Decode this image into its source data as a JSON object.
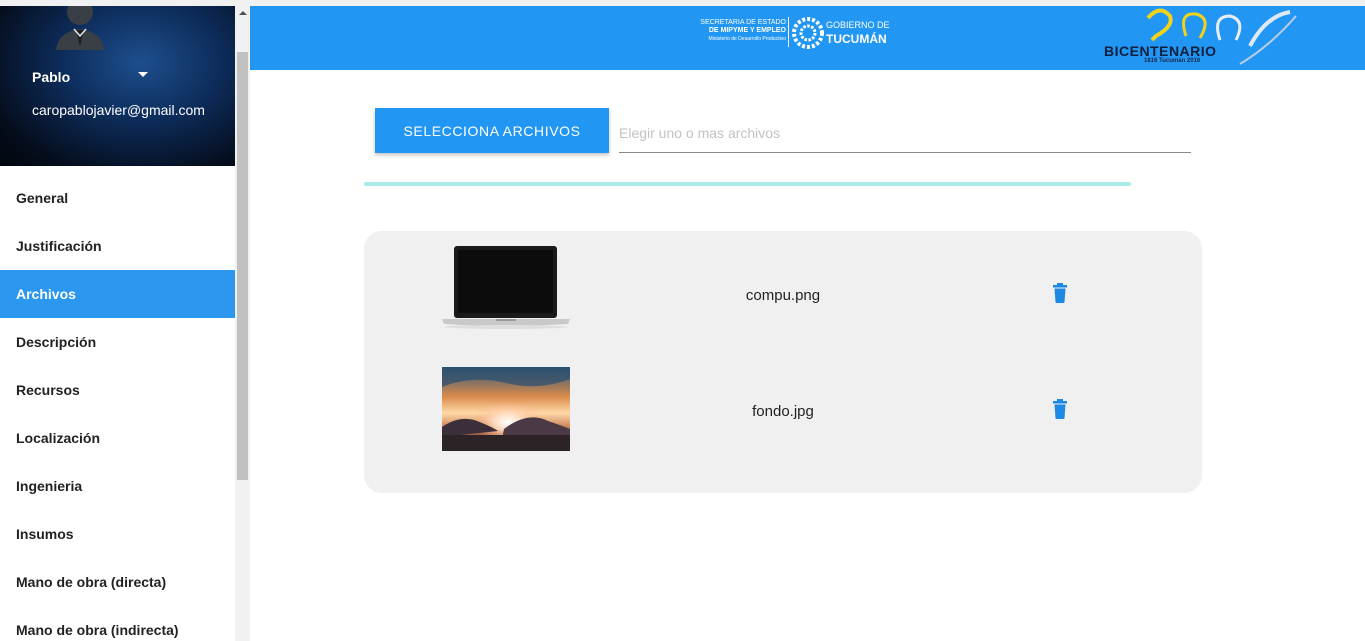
{
  "user": {
    "name": "Pablo",
    "email": "caropablojavier@gmail.com"
  },
  "sidebar": {
    "items": [
      {
        "label": "General",
        "active": false
      },
      {
        "label": "Justificación",
        "active": false
      },
      {
        "label": "Archivos",
        "active": true
      },
      {
        "label": "Descripción",
        "active": false
      },
      {
        "label": "Recursos",
        "active": false
      },
      {
        "label": "Localización",
        "active": false
      },
      {
        "label": "Ingenieria",
        "active": false
      },
      {
        "label": "Insumos",
        "active": false
      },
      {
        "label": "Mano de obra (directa)",
        "active": false
      },
      {
        "label": "Mano de obra (indirecta)",
        "active": false
      }
    ]
  },
  "header": {
    "secretaria_line1": "SECRETARIA DE ESTADO",
    "secretaria_line2": "DE MIPYME Y EMPLEO",
    "secretaria_line3": "Ministerio de Desarrollo Productivo",
    "gobierno_line1": "GOBIERNO DE",
    "gobierno_line2": "TUCUMÁN",
    "bicentenario": "BICENTENARIO",
    "bicentenario_sub": "1816 Tucumán 2016"
  },
  "upload": {
    "button_label": "SELECCIONA ARCHIVOS",
    "input_placeholder": "Elegir uno o mas archivos",
    "input_value": ""
  },
  "files": [
    {
      "name": "compu.png",
      "thumbnail": "laptop-image",
      "action_icon": "trash-icon"
    },
    {
      "name": "fondo.jpg",
      "thumbnail": "sunset-landscape-image",
      "action_icon": "trash-icon"
    }
  ],
  "colors": {
    "primary": "#2196f3",
    "active_item": "#2b97ee",
    "progress": "#a8ecea",
    "file_list_bg": "#f0f0f0",
    "delete_icon": "#1e88e5"
  }
}
